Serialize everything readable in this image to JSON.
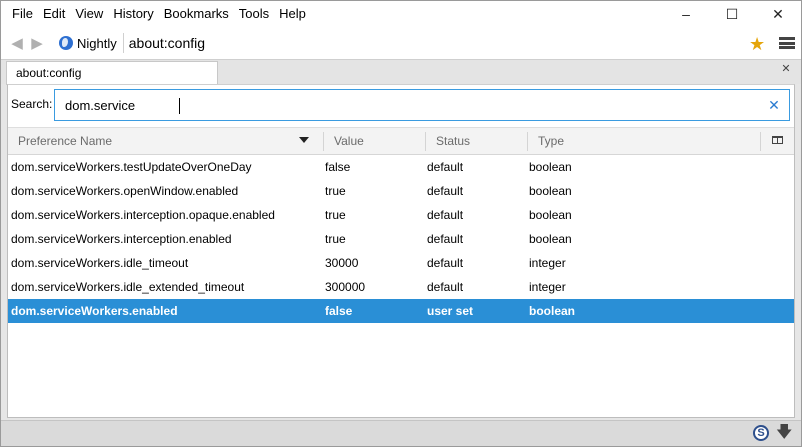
{
  "menubar": {
    "items": [
      "File",
      "Edit",
      "View",
      "History",
      "Bookmarks",
      "Tools",
      "Help"
    ]
  },
  "window_controls": {
    "minimize": "–",
    "maximize": "☐",
    "close": "✕"
  },
  "navbar": {
    "identity_label": "Nightly",
    "url": "about:config"
  },
  "tabs": [
    {
      "label": "about:config"
    }
  ],
  "search": {
    "label": "Search:",
    "value": "dom.service"
  },
  "table": {
    "columns": [
      "Preference Name",
      "Value",
      "Status",
      "Type"
    ],
    "rows": [
      {
        "name": "dom.serviceWorkers.testUpdateOverOneDay",
        "value": "false",
        "status": "default",
        "type": "boolean"
      },
      {
        "name": "dom.serviceWorkers.openWindow.enabled",
        "value": "true",
        "status": "default",
        "type": "boolean"
      },
      {
        "name": "dom.serviceWorkers.interception.opaque.enabled",
        "value": "true",
        "status": "default",
        "type": "boolean"
      },
      {
        "name": "dom.serviceWorkers.interception.enabled",
        "value": "true",
        "status": "default",
        "type": "boolean"
      },
      {
        "name": "dom.serviceWorkers.idle_timeout",
        "value": "30000",
        "status": "default",
        "type": "integer"
      },
      {
        "name": "dom.serviceWorkers.idle_extended_timeout",
        "value": "300000",
        "status": "default",
        "type": "integer"
      },
      {
        "name": "dom.serviceWorkers.enabled",
        "value": "false",
        "status": "user set",
        "type": "boolean"
      }
    ],
    "selected_row_index": 6
  },
  "statusbar": {
    "addon_icon_letter": "S"
  },
  "icons": {
    "back": "back-arrow-icon",
    "forward": "forward-arrow-icon",
    "identity": "globe-icon",
    "bookmark": "star-icon",
    "menu": "hamburger-menu-icon",
    "tab_close": "close-icon",
    "search_clear": "clear-icon",
    "sort": "sort-descending-icon",
    "column_picker": "column-picker-icon",
    "addon": "addon-s-icon",
    "downloads": "download-arrow-icon"
  },
  "colors": {
    "selection": "#2a8fd6",
    "focus_border": "#3a9be0",
    "star": "#e5a50a"
  }
}
